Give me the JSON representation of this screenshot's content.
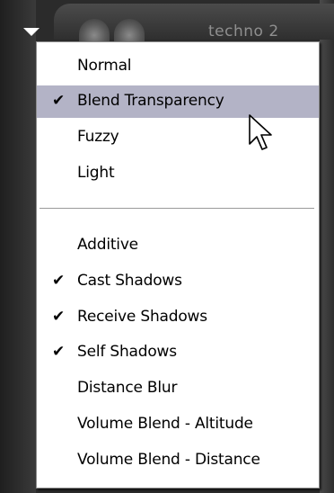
{
  "window": {
    "title": "techno 2"
  },
  "menu": {
    "section1": [
      {
        "label": "Normal",
        "checked": false,
        "highlighted": false
      },
      {
        "label": "Blend Transparency",
        "checked": true,
        "highlighted": true
      },
      {
        "label": "Fuzzy",
        "checked": false,
        "highlighted": false
      },
      {
        "label": "Light",
        "checked": false,
        "highlighted": false
      }
    ],
    "section2": [
      {
        "label": "Additive",
        "checked": false
      },
      {
        "label": "Cast Shadows",
        "checked": true
      },
      {
        "label": "Receive Shadows",
        "checked": true
      },
      {
        "label": "Self Shadows",
        "checked": true
      },
      {
        "label": "Distance Blur",
        "checked": false
      },
      {
        "label": "Volume Blend - Altitude",
        "checked": false
      },
      {
        "label": "Volume Blend - Distance",
        "checked": false
      }
    ],
    "check_glyph": "✔",
    "highlight_color": "#b3b3c6"
  },
  "icons": {
    "dropdown": "triangle-down-icon",
    "cursor": "arrow-pointer-icon"
  }
}
